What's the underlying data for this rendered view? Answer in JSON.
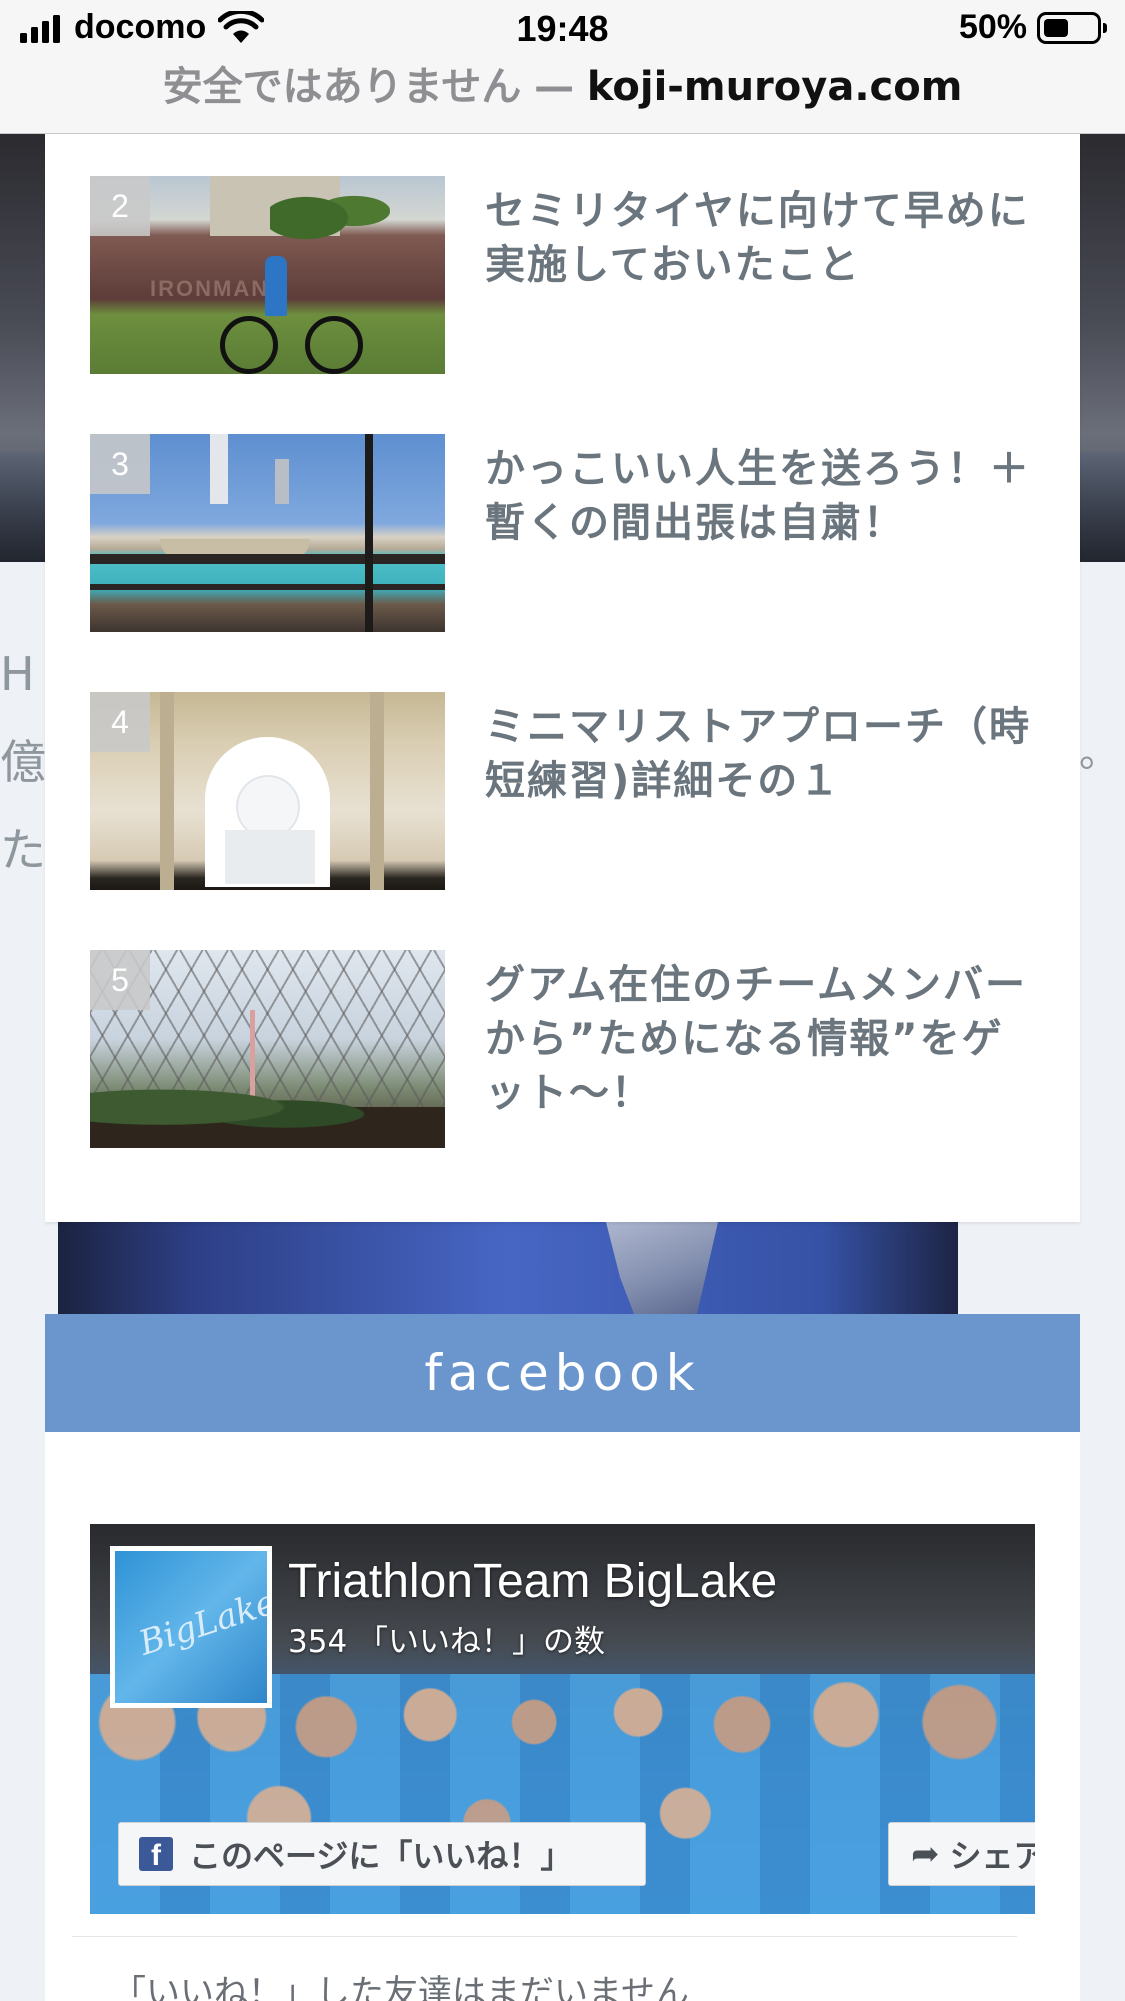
{
  "status_bar": {
    "carrier": "docomo",
    "time": "19:48",
    "battery_percent": "50%",
    "battery_level": 0.5
  },
  "address_bar": {
    "security_warning": "安全ではありません",
    "separator": "—",
    "domain": "koji-muroya.com"
  },
  "background": {
    "left_chars": [
      "H",
      "億",
      "た"
    ],
    "right_char": "。"
  },
  "popular_posts": [
    {
      "rank": "2",
      "title": "セミリタイヤに向けて早めに実施しておいたこと"
    },
    {
      "rank": "3",
      "title": "かっこいい人生を送ろう！＋暫くの間出張は自粛！"
    },
    {
      "rank": "4",
      "title": "ミニマリストアプローチ（時短練習)詳細その１"
    },
    {
      "rank": "5",
      "title": "グアム在住のチームメンバーから”ためになる情報”をゲット～！"
    }
  ],
  "facebook": {
    "header": "facebook",
    "page_name": "TriathlonTeam BigLake",
    "likes_text": "354 「いいね！」の数",
    "like_button": "このページに「いいね！」",
    "share_button": "シェア",
    "below_text": "「いいね！」した友達はまだいません",
    "brand_color": "#6b96cd",
    "fb_blue": "#3b5998"
  }
}
